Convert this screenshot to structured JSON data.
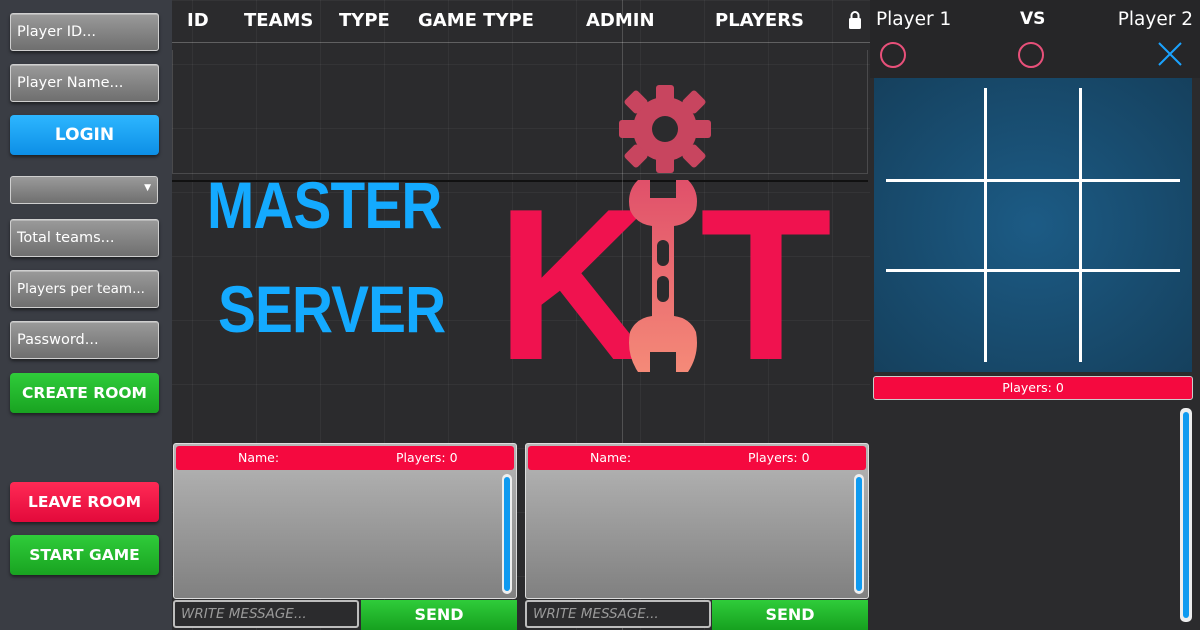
{
  "sidebar": {
    "player_id_placeholder": "Player ID...",
    "player_name_placeholder": "Player Name...",
    "login_label": "LOGIN",
    "total_teams_placeholder": "Total teams...",
    "players_per_team_placeholder": "Players per team...",
    "password_placeholder": "Password...",
    "create_room_label": "CREATE ROOM",
    "leave_room_label": "LEAVE ROOM",
    "start_game_label": "START GAME"
  },
  "table": {
    "columns": [
      "ID",
      "TEAMS",
      "TYPE",
      "GAME TYPE",
      "ADMIN",
      "PLAYERS"
    ],
    "lock_icon": "lock-icon"
  },
  "logo": {
    "line1": "MASTER",
    "line2": "SERVER",
    "kit_letters": [
      "K",
      "T"
    ],
    "icons": [
      "gear-icon",
      "wrench-icon"
    ]
  },
  "chats": [
    {
      "name_label": "Name:",
      "players_label": "Players: 0",
      "placeholder": "WRITE MESSAGE...",
      "send_label": "SEND"
    },
    {
      "name_label": "Name:",
      "players_label": "Players: 0",
      "placeholder": "WRITE MESSAGE...",
      "send_label": "SEND"
    }
  ],
  "game": {
    "player1": "Player 1",
    "vs": "VS",
    "player2": "Player 2",
    "players_label": "Players: 0",
    "marks": [
      "circle",
      "circle",
      "cross"
    ]
  },
  "colors": {
    "accent_blue": "#14aaff",
    "accent_red": "#f0124f",
    "button_green": "#1fb52a"
  }
}
